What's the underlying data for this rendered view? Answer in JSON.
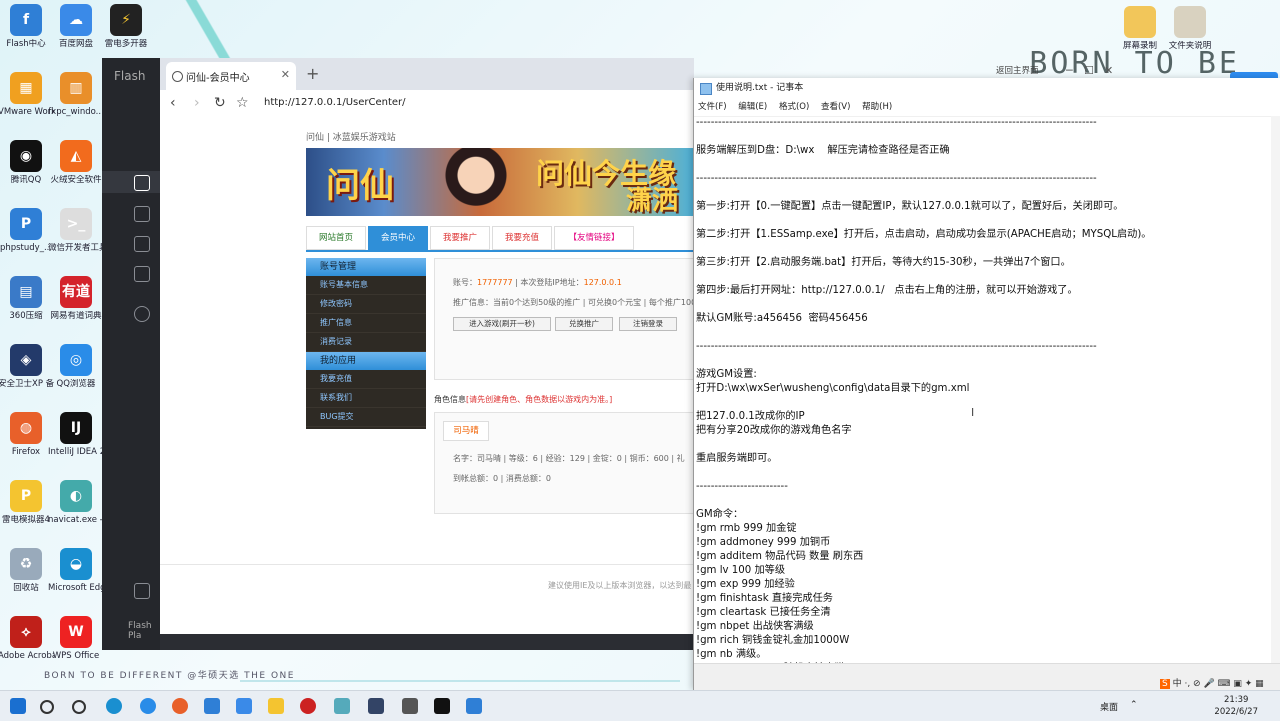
{
  "desktop": {
    "icons_left": [
      {
        "label": "Flash中心",
        "color": "#2f7fd6",
        "glyph": "f"
      },
      {
        "label": "VMware Workstati...",
        "color": "#f0a020",
        "glyph": "▦"
      },
      {
        "label": "腾讯QQ",
        "color": "#111",
        "glyph": "◉"
      },
      {
        "label": "phpstudy_...",
        "color": "#2f7fd6",
        "glyph": "P"
      },
      {
        "label": "360压缩",
        "color": "#3a7ac8",
        "glyph": "▤"
      },
      {
        "label": "安全卫士XP 备用/安全助手",
        "color": "#233a6a",
        "glyph": "◈"
      },
      {
        "label": "Firefox",
        "color": "#e8602a",
        "glyph": "◍"
      },
      {
        "label": "雷电模拟器4",
        "color": "#f4c430",
        "glyph": "P"
      },
      {
        "label": "回收站",
        "color": "#9ab",
        "glyph": "♻"
      },
      {
        "label": "Adobe Acrobat DC",
        "color": "#c0201a",
        "glyph": "⟡"
      }
    ],
    "icons_col2": [
      {
        "label": "百度网盘",
        "color": "#3a8ae8",
        "glyph": "☁"
      },
      {
        "label": "fxpc_windo...",
        "color": "#e98f2a",
        "glyph": "▥"
      },
      {
        "label": "火绒安全软件",
        "color": "#f26b1d",
        "glyph": "◭"
      },
      {
        "label": "微信开发者工具",
        "color": "#ddd",
        "glyph": ">_"
      },
      {
        "label": "网易有道词典",
        "color": "#d4232b",
        "glyph": "有道"
      },
      {
        "label": "QQ浏览器",
        "color": "#2a8ce8",
        "glyph": "◎"
      },
      {
        "label": "IntelliJ IDEA 2019.3.3 x64",
        "color": "#111",
        "glyph": "IJ"
      },
      {
        "label": "navicat.exe - 快捷方式",
        "color": "#4aa",
        "glyph": "◐"
      },
      {
        "label": "Microsoft Edge",
        "color": "#1a8fd0",
        "glyph": "◒"
      },
      {
        "label": "WPS Office",
        "color": "#e22",
        "glyph": "W"
      }
    ],
    "icon_col3": {
      "label": "雷电多开器",
      "color": "#f4c430",
      "glyph": "⚡"
    },
    "folders_right": [
      {
        "label": "屏幕录制"
      },
      {
        "label": "文件夹说明"
      }
    ],
    "born_text": "BORN TO BE",
    "born_small": "BORN TO BE DIFFERENT  @华硕天选  THE ONE"
  },
  "flash_app": {
    "title": "Flash",
    "play_label": "Flash Pla",
    "back_main": "返回主界面"
  },
  "browser": {
    "tab_title": "问仙-会员中心",
    "url": "http://127.0.0.1/UserCenter/",
    "breadcrumb": "问仙 | 冰蓝娱乐游戏站",
    "banner_title_left": "问仙",
    "banner_title_right1": "问仙今生缘",
    "banner_title_right2": "潇洒",
    "menu": [
      "网站首页",
      "会员中心",
      "我要推广",
      "我要充值",
      "【友情链接】"
    ],
    "side_sections": [
      {
        "title": "账号管理",
        "items": [
          "账号基本信息",
          "修改密码",
          "推广信息",
          "消费记录"
        ]
      },
      {
        "title": "我的应用",
        "items": [
          "我要充值",
          "联系我们",
          "BUG提交"
        ]
      }
    ],
    "account": {
      "account_label": "账号：",
      "account_value": "1777777",
      "ip_label": "本次登陆IP地址：",
      "ip_value": "127.0.0.1",
      "promo_line": "推广信息：当前0个达到50级的推广 | 可兑换0个元宝 | 每个推广100",
      "btn_enter": "进入游戏(刷开一秒)",
      "btn_exchange": "兑换推广",
      "btn_logout": "注销登录"
    },
    "role": {
      "header": "角色信息",
      "header_note": "[请先创建角色、角色数据以游戏内为准。]",
      "tab": "司马晴",
      "line1": "名字：司马晴 | 等级：6 | 经验：129 | 金锭：0 | 铜币：600 | 礼",
      "line2": "到帐总额：0 | 消费总额：0"
    },
    "footer_note": "建议使用IE及以上版本浏览器，以达到最"
  },
  "notepad": {
    "title": "使用说明.txt - 记事本",
    "menu": [
      "文件(F)",
      "编辑(E)",
      "格式(O)",
      "查看(V)",
      "帮助(H)"
    ],
    "lines": [
      "-------------------------------------------------------------------------------------------------------------",
      "",
      "服务端解压到D盘：D:\\wx    解压完请检查路径是否正确",
      "",
      "-------------------------------------------------------------------------------------------------------------",
      "",
      "第一步:打开【0.一键配置】点击一键配置IP，默认127.0.0.1就可以了，配置好后，关闭即可。",
      "",
      "第二步:打开【1.ESSamp.exe】打开后，点击启动，启动成功会显示(APACHE启动；MYSQL启动)。",
      "",
      "第三步:打开【2.启动服务端.bat】打开后，等待大约15-30秒，一共弹出7个窗口。",
      "",
      "第四步:最后打开网址：http://127.0.0.1/   点击右上角的注册，就可以开始游戏了。",
      "",
      "默认GM账号:a456456  密码456456",
      "",
      "-------------------------------------------------------------------------------------------------------------",
      "",
      "游戏GM设置:",
      "打开D:\\wx\\wxSer\\wusheng\\config\\data目录下的gm.xml",
      "",
      "把127.0.0.1改成你的IP",
      "把有分享20改成你的游戏角色名字",
      "",
      "重启服务端即可。",
      "",
      "-------------------------",
      "",
      "GM命令：",
      "!gm rmb 999 加金锭",
      "!gm addmoney 999 加铜币",
      "!gm additem 物品代码 数量 刷东西",
      "!gm lv 100 加等级",
      "!gm exp 999 加经验",
      "!gm finishtask 直接完成任务",
      "!gm cleartask 已接任务全清",
      "!gm nbpet 出战侠客满级",
      "!gm rich 铜钱金锭礼金加1000W",
      "!gm nb 满级。",
      "!gm dianzi guozi 随机商镇出猫"
    ]
  },
  "taskbar": {
    "desktop_label": "桌面",
    "ime": "中 ·, ⊘ 🎤 ⌨ ▣ ✦ ▦",
    "time": "21:39",
    "date": "2022/6/27"
  }
}
